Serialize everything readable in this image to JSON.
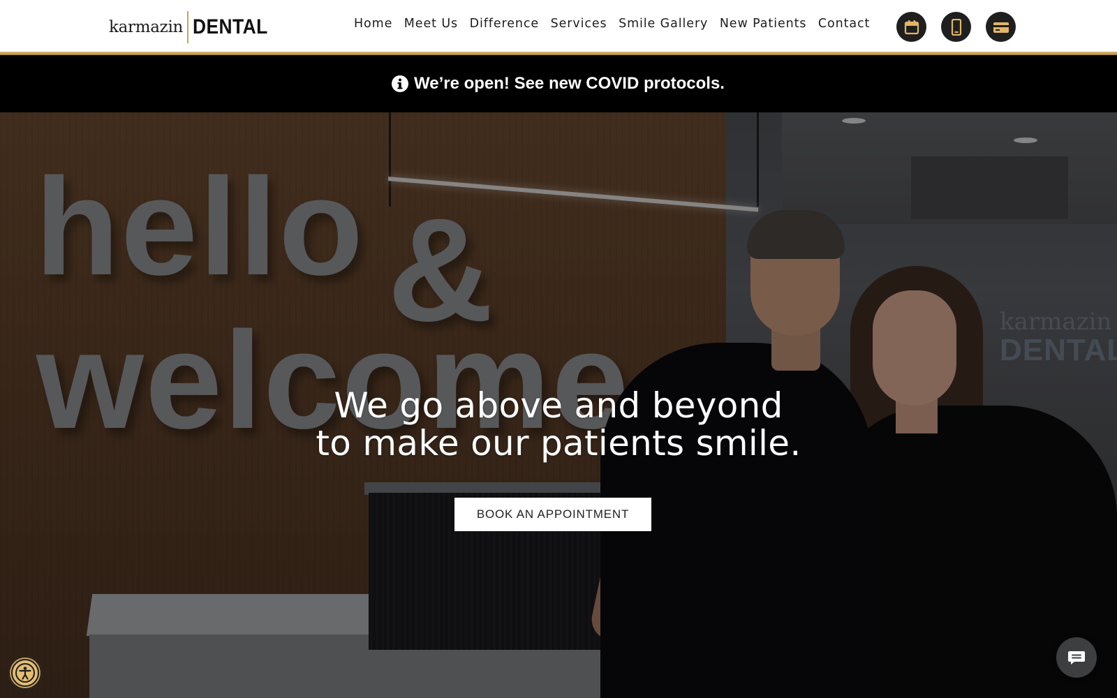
{
  "header": {
    "logo": {
      "script": "karmazin",
      "strong": "DENTAL"
    },
    "nav": [
      {
        "label": "Home"
      },
      {
        "label": "Meet Us"
      },
      {
        "label": "Difference"
      },
      {
        "label": "Services"
      },
      {
        "label": "Smile Gallery"
      },
      {
        "label": "New Patients"
      },
      {
        "label": "Contact"
      }
    ],
    "action_icons": [
      "calendar-icon",
      "phone-icon",
      "credit-card-icon"
    ],
    "accent_color": "#c9a25e"
  },
  "announcement": {
    "icon": "info-icon",
    "text": "We’re open! See new COVID protocols."
  },
  "hero": {
    "wall_sign": {
      "line1_left": "hello",
      "line1_right": "&",
      "line2": "welcome."
    },
    "room_sign": {
      "script": "karmazin",
      "strong": "DENTAL"
    },
    "headline": {
      "line1": "We go above and beyond",
      "line2": "to make our patients smile."
    },
    "cta_label": "BOOK AN APPOINTMENT"
  },
  "widgets": {
    "accessibility_icon": "accessibility-icon",
    "chat_icon": "chat-icon"
  }
}
